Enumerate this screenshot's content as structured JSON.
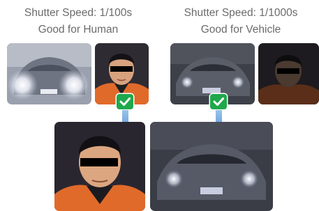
{
  "left_panel": {
    "caption_line1": "Shutter Speed: 1/100s",
    "caption_line2": "Good for Human",
    "thumbnails": [
      "car-overexposed",
      "face-well-exposed"
    ],
    "output_image": "face-enlarged",
    "check_icon": "checkmark-icon",
    "arrow_icon": "down-arrow-icon"
  },
  "right_panel": {
    "caption_line1": "Shutter Speed: 1/1000s",
    "caption_line2": "Good for Vehicle",
    "thumbnails": [
      "car-well-exposed",
      "face-underexposed"
    ],
    "output_image": "car-enlarged",
    "check_icon": "checkmark-icon",
    "arrow_icon": "down-arrow-icon"
  },
  "colors": {
    "caption_text": "#6b6b6b",
    "check_green": "#1ea84b",
    "arrow_blue": "#6fa8dc"
  }
}
